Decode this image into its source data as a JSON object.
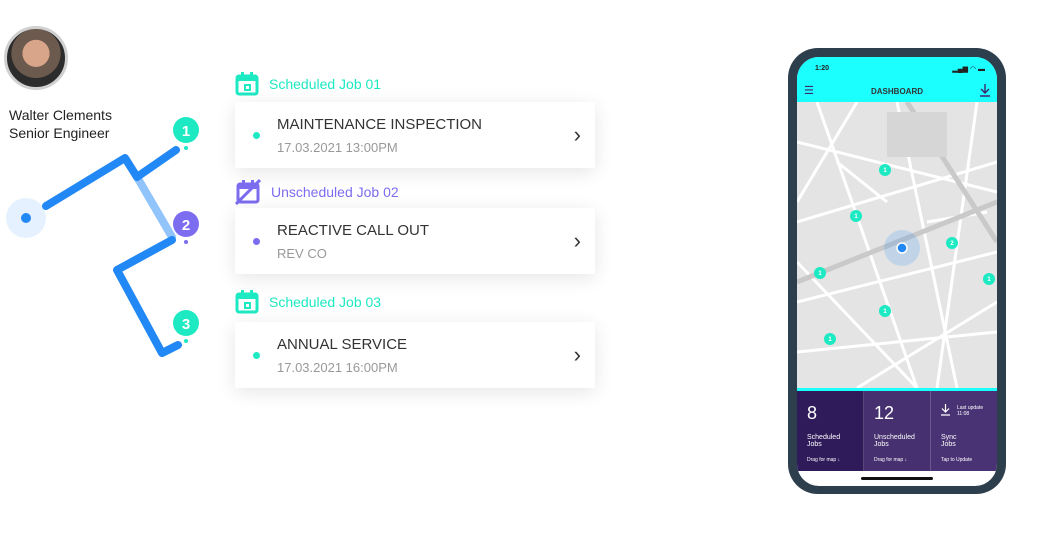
{
  "user": {
    "name": "Walter Clements",
    "role": "Senior Engineer"
  },
  "colors": {
    "scheduled": "#1de9c3",
    "unscheduled": "#7c6cf0",
    "route": "#2288f5",
    "phone_accent": "#1cffff",
    "stats_bg": "#3d2768"
  },
  "route_pins": [
    "1",
    "2",
    "3"
  ],
  "jobs": [
    {
      "label": "Scheduled Job 01",
      "icon": "calendar-icon",
      "title": "MAINTENANCE INSPECTION",
      "sub": "17.03.2021   13:00PM"
    },
    {
      "label": "Unscheduled Job 02",
      "icon": "calendar-off-icon",
      "title": "REACTIVE CALL OUT",
      "sub": "REV CO"
    },
    {
      "label": "Scheduled Job 03",
      "icon": "calendar-icon",
      "title": "ANNUAL SERVICE",
      "sub": "17.03.2021   16:00PM"
    }
  ],
  "phone": {
    "time": "1:20",
    "title": "DASHBOARD",
    "map_pins": [
      "1",
      "1",
      "2",
      "1",
      "1",
      "1",
      "1"
    ],
    "stats": [
      {
        "value": "8",
        "label1": "Scheduled",
        "label2": "Jobs",
        "hint": "Drag for map ↓"
      },
      {
        "value": "12",
        "label1": "Unscheduled",
        "label2": "Jobs",
        "hint": "Drag for map ↓"
      },
      {
        "value": "",
        "label1": "Sync",
        "label2": "Jobs",
        "hint": "Tap to Update",
        "update_label": "Last update",
        "update_time": "11:08"
      }
    ]
  }
}
